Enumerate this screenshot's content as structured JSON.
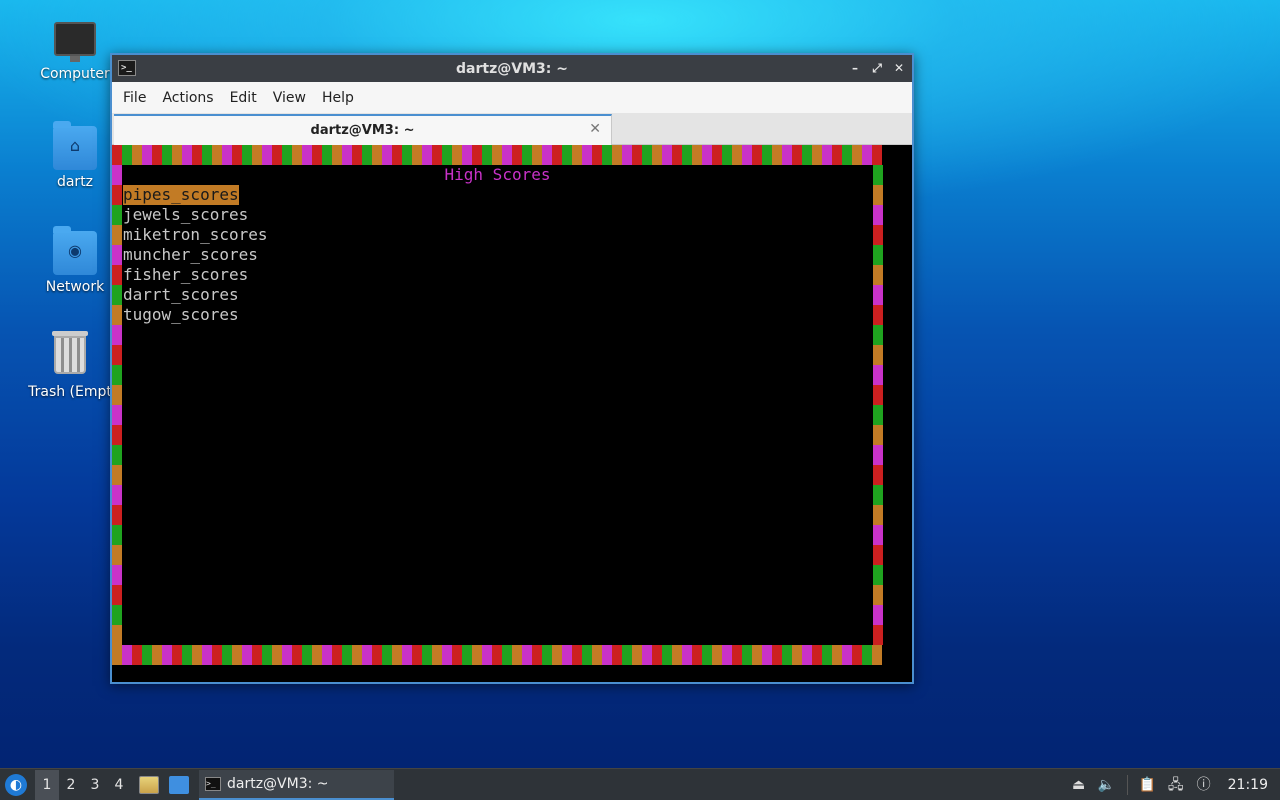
{
  "desktop": {
    "icons": [
      {
        "label": "Computer",
        "icon": "computer-icon"
      },
      {
        "label": "dartz",
        "icon": "home-folder-icon"
      },
      {
        "label": "Network",
        "icon": "network-folder-icon"
      },
      {
        "label": "Trash (Empt",
        "icon": "trash-icon"
      }
    ]
  },
  "window": {
    "title": "dartz@VM3: ~",
    "controls": {
      "minimize": "–",
      "maximize": "⤢",
      "close": "✕"
    },
    "menu": [
      "File",
      "Actions",
      "Edit",
      "View",
      "Help"
    ],
    "tab": {
      "label": "dartz@VM3: ~",
      "close": "✕"
    }
  },
  "terminal": {
    "title": "High Scores",
    "items": [
      "pipes_scores",
      "jewels_scores",
      "miketron_scores",
      "muncher_scores",
      "fisher_scores",
      "darrt_scores",
      "tugow_scores"
    ],
    "selected_index": 0,
    "border_colors": [
      "#cc2020",
      "#1fa31f",
      "#c27b25",
      "#c932c9"
    ],
    "title_color": "#c932c9",
    "selected_bg": "#c27b25"
  },
  "taskbar": {
    "workspaces": [
      "1",
      "2",
      "3",
      "4"
    ],
    "active_workspace": "1",
    "task_label": "dartz@VM3: ~",
    "clock": "21:19"
  }
}
